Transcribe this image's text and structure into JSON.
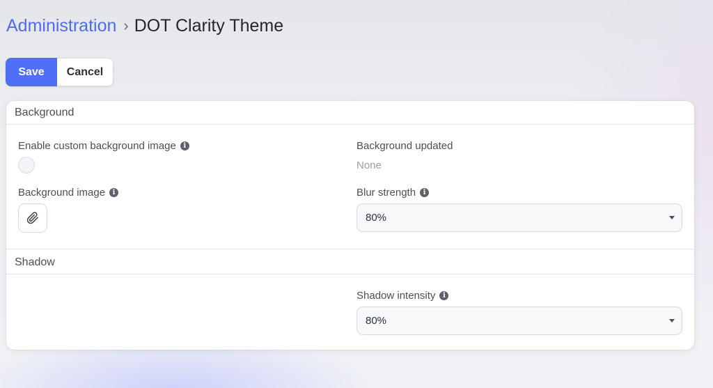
{
  "breadcrumb": {
    "parent": "Administration",
    "separator": "›",
    "current": "DOT Clarity Theme"
  },
  "toolbar": {
    "save_label": "Save",
    "cancel_label": "Cancel"
  },
  "sections": {
    "background": {
      "title": "Background",
      "enable_label": "Enable custom background image",
      "enable_value": false,
      "image_label": "Background image",
      "updated_label": "Background updated",
      "updated_value": "None",
      "blur_label": "Blur strength",
      "blur_value": "80%"
    },
    "shadow": {
      "title": "Shadow",
      "intensity_label": "Shadow intensity",
      "intensity_value": "80%"
    }
  },
  "icons": {
    "info": "info-icon",
    "attach": "paperclip-icon",
    "dropdown": "chevron-down-icon"
  },
  "colors": {
    "accent": "#4f6ff5",
    "link": "#4f6cf0"
  }
}
